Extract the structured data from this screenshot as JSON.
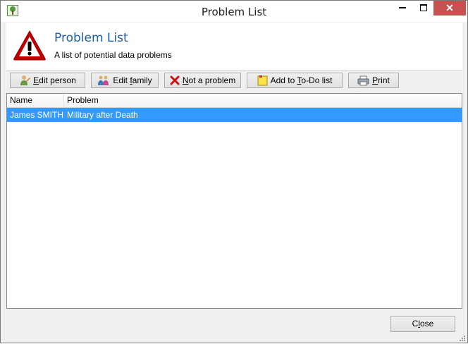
{
  "window": {
    "title": "Problem List"
  },
  "header": {
    "title": "Problem List",
    "subtitle": "A list of potential data problems"
  },
  "toolbar": {
    "edit_person": "Edit person",
    "edit_family": "Edit family",
    "not_a_problem": "Not a problem",
    "add_todo": "Add to To-Do list",
    "print": "Print"
  },
  "table": {
    "columns": [
      "Name",
      "Problem"
    ],
    "rows": [
      {
        "name": "James SMITH",
        "problem": "Military after Death",
        "selected": true
      }
    ]
  },
  "footer": {
    "close_label": "Close"
  },
  "colors": {
    "accent": "#1e5fa8",
    "selection": "#3399ff",
    "close_hover": "#c75050"
  },
  "icons": [
    "tree-app-icon",
    "warning-icon",
    "person-icon",
    "family-icon",
    "red-x-icon",
    "note-icon",
    "printer-icon"
  ]
}
